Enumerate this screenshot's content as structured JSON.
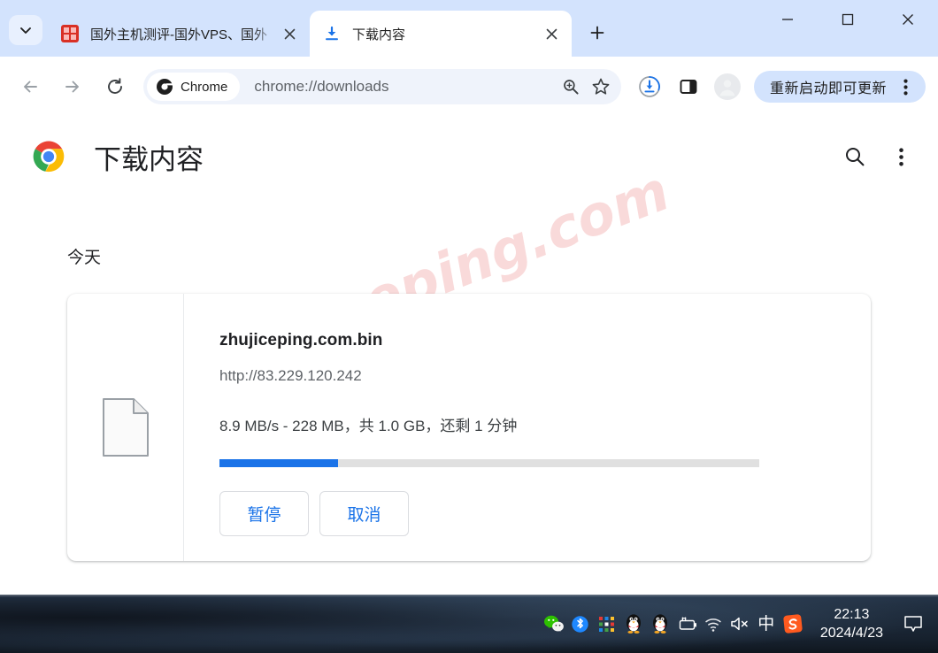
{
  "window": {
    "minimize_label": "最小化",
    "maximize_label": "最大化",
    "close_label": "关闭"
  },
  "tabstrip": {
    "tab_search_name": "tab-search",
    "new_tab_label": "新建标签页",
    "tabs": [
      {
        "title": "国外主机测评-国外VPS、国外",
        "favicon": "red-seal-icon",
        "active": false
      },
      {
        "title": "下载内容",
        "favicon": "download-icon",
        "active": true
      }
    ]
  },
  "toolbar": {
    "back_label": "返回",
    "forward_label": "前进",
    "reload_label": "重新加载",
    "chrome_chip_label": "Chrome",
    "url": "chrome://downloads",
    "zoom_icon_label": "缩放",
    "bookmark_icon_label": "收藏",
    "downloads_icon_label": "下载内容",
    "sidepanel_icon_label": "侧边栏",
    "profile_icon_label": "个人资料",
    "update_button_label": "重新启动即可更新",
    "menu_label": "自定义及控制"
  },
  "page": {
    "title": "下载内容",
    "search_label": "搜索下载内容",
    "menu_label": "更多操作",
    "watermark": "zhujiceping.com",
    "group_label": "今天",
    "download": {
      "file_icon": "generic-file-icon",
      "filename": "zhujiceping.com.bin",
      "url": "http://83.229.120.242",
      "status": "8.9 MB/s - 228 MB，共 1.0 GB，还剩 1 分钟",
      "progress_percent": 22,
      "buttons": [
        {
          "label": "暂停",
          "name": "pause-download-button"
        },
        {
          "label": "取消",
          "name": "cancel-download-button"
        }
      ]
    }
  },
  "taskbar": {
    "tray_icons": [
      {
        "name": "wechat-icon"
      },
      {
        "name": "bluetooth-icon"
      },
      {
        "name": "color-grid-icon"
      },
      {
        "name": "qq-penguin-icon"
      },
      {
        "name": "qq-penguin-2-icon"
      },
      {
        "name": "battery-charging-icon"
      },
      {
        "name": "wifi-icon"
      },
      {
        "name": "speaker-muted-icon"
      },
      {
        "name": "ime-chinese-icon"
      },
      {
        "name": "sogou-icon"
      }
    ],
    "ime_label": "中",
    "clock_time": "22:13",
    "clock_date": "2024/4/23",
    "notification_label": "通知"
  },
  "colors": {
    "tabstrip_bg": "#d3e3fd",
    "accent_blue": "#1a73e8",
    "progress_track": "#e0e0e0",
    "watermark_pink": "#f9dada",
    "taskbar_dark": "#16202c"
  }
}
